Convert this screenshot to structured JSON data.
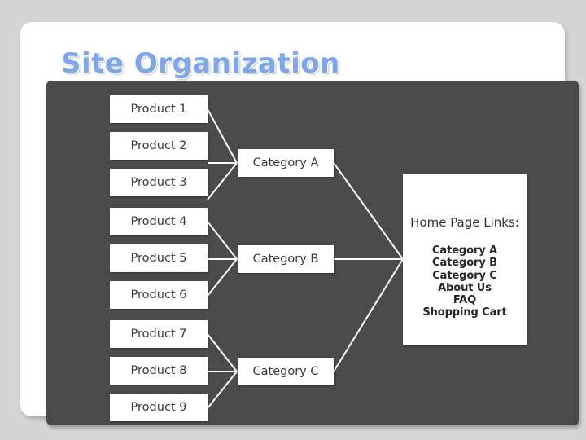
{
  "slide": {
    "title": "Site Organization",
    "title_color": "#7ea7e8",
    "card_background": "#ffffff",
    "page_background": "#d5d5d5",
    "panel_background": "#4b4b4b",
    "node_background": "#ffffff",
    "node_text_color": "#3a3a3a",
    "connector_color": "#ffffff"
  },
  "diagram": {
    "products": [
      {
        "label": "Product 1"
      },
      {
        "label": "Product 2"
      },
      {
        "label": "Product 3"
      },
      {
        "label": "Product 4"
      },
      {
        "label": "Product 5"
      },
      {
        "label": "Product 6"
      },
      {
        "label": "Product 7"
      },
      {
        "label": "Product 8"
      },
      {
        "label": "Product 9"
      }
    ],
    "categories": [
      {
        "label": "Category A"
      },
      {
        "label": "Category B"
      },
      {
        "label": "Category C"
      }
    ],
    "home_page_links": {
      "heading": "Home Page Links:",
      "items": [
        {
          "label": "Category A"
        },
        {
          "label": "Category B"
        },
        {
          "label": "Category C"
        },
        {
          "label": "About Us"
        },
        {
          "label": "FAQ"
        },
        {
          "label": "Shopping Cart"
        }
      ]
    }
  }
}
